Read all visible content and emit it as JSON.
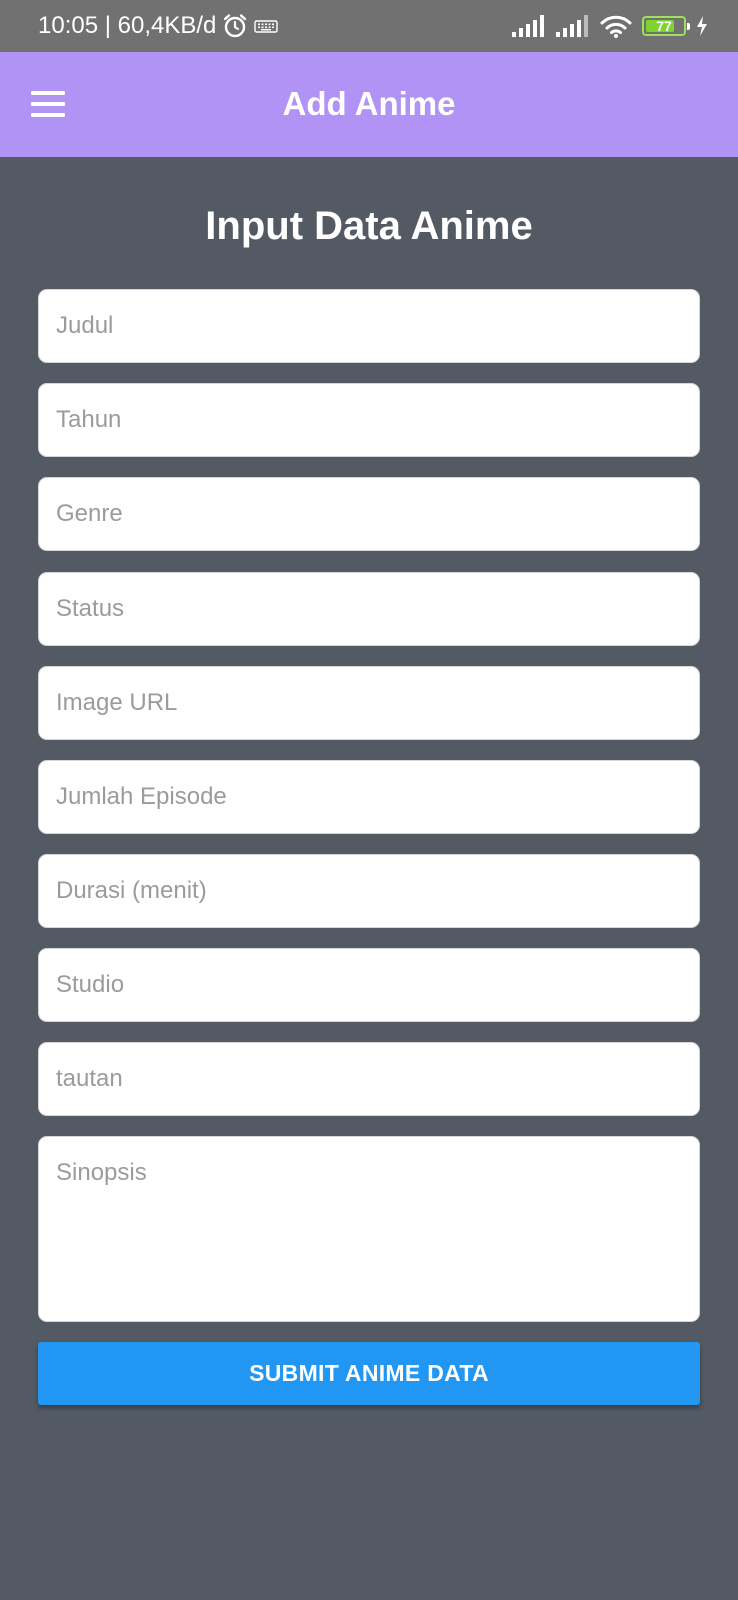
{
  "status_bar": {
    "time_and_speed": "10:05 | 60,4KB/d",
    "battery_level": "77",
    "battery_fraction": 0.77,
    "icons": [
      "alarm-icon",
      "keyboard-icon",
      "signal-icon",
      "signal-icon",
      "wifi-icon",
      "battery-icon",
      "charging-icon"
    ],
    "battery_color": "#7ed332"
  },
  "app_bar": {
    "title": "Add Anime",
    "menu_icon": "hamburger-menu-icon",
    "background": "#b192f5"
  },
  "form": {
    "heading": "Input Data Anime",
    "fields": [
      {
        "name": "judul",
        "placeholder": "Judul",
        "value": ""
      },
      {
        "name": "tahun",
        "placeholder": "Tahun",
        "value": ""
      },
      {
        "name": "genre",
        "placeholder": "Genre",
        "value": ""
      },
      {
        "name": "status",
        "placeholder": "Status",
        "value": ""
      },
      {
        "name": "image_url",
        "placeholder": "Image URL",
        "value": ""
      },
      {
        "name": "jumlah_episode",
        "placeholder": "Jumlah Episode",
        "value": ""
      },
      {
        "name": "durasi",
        "placeholder": "Durasi (menit)",
        "value": ""
      },
      {
        "name": "studio",
        "placeholder": "Studio",
        "value": ""
      },
      {
        "name": "tautan",
        "placeholder": "tautan",
        "value": ""
      },
      {
        "name": "sinopsis",
        "placeholder": "Sinopsis",
        "value": ""
      }
    ],
    "submit_label": "SUBMIT ANIME DATA",
    "submit_color": "#2196f3"
  },
  "page_background": "#535a63"
}
